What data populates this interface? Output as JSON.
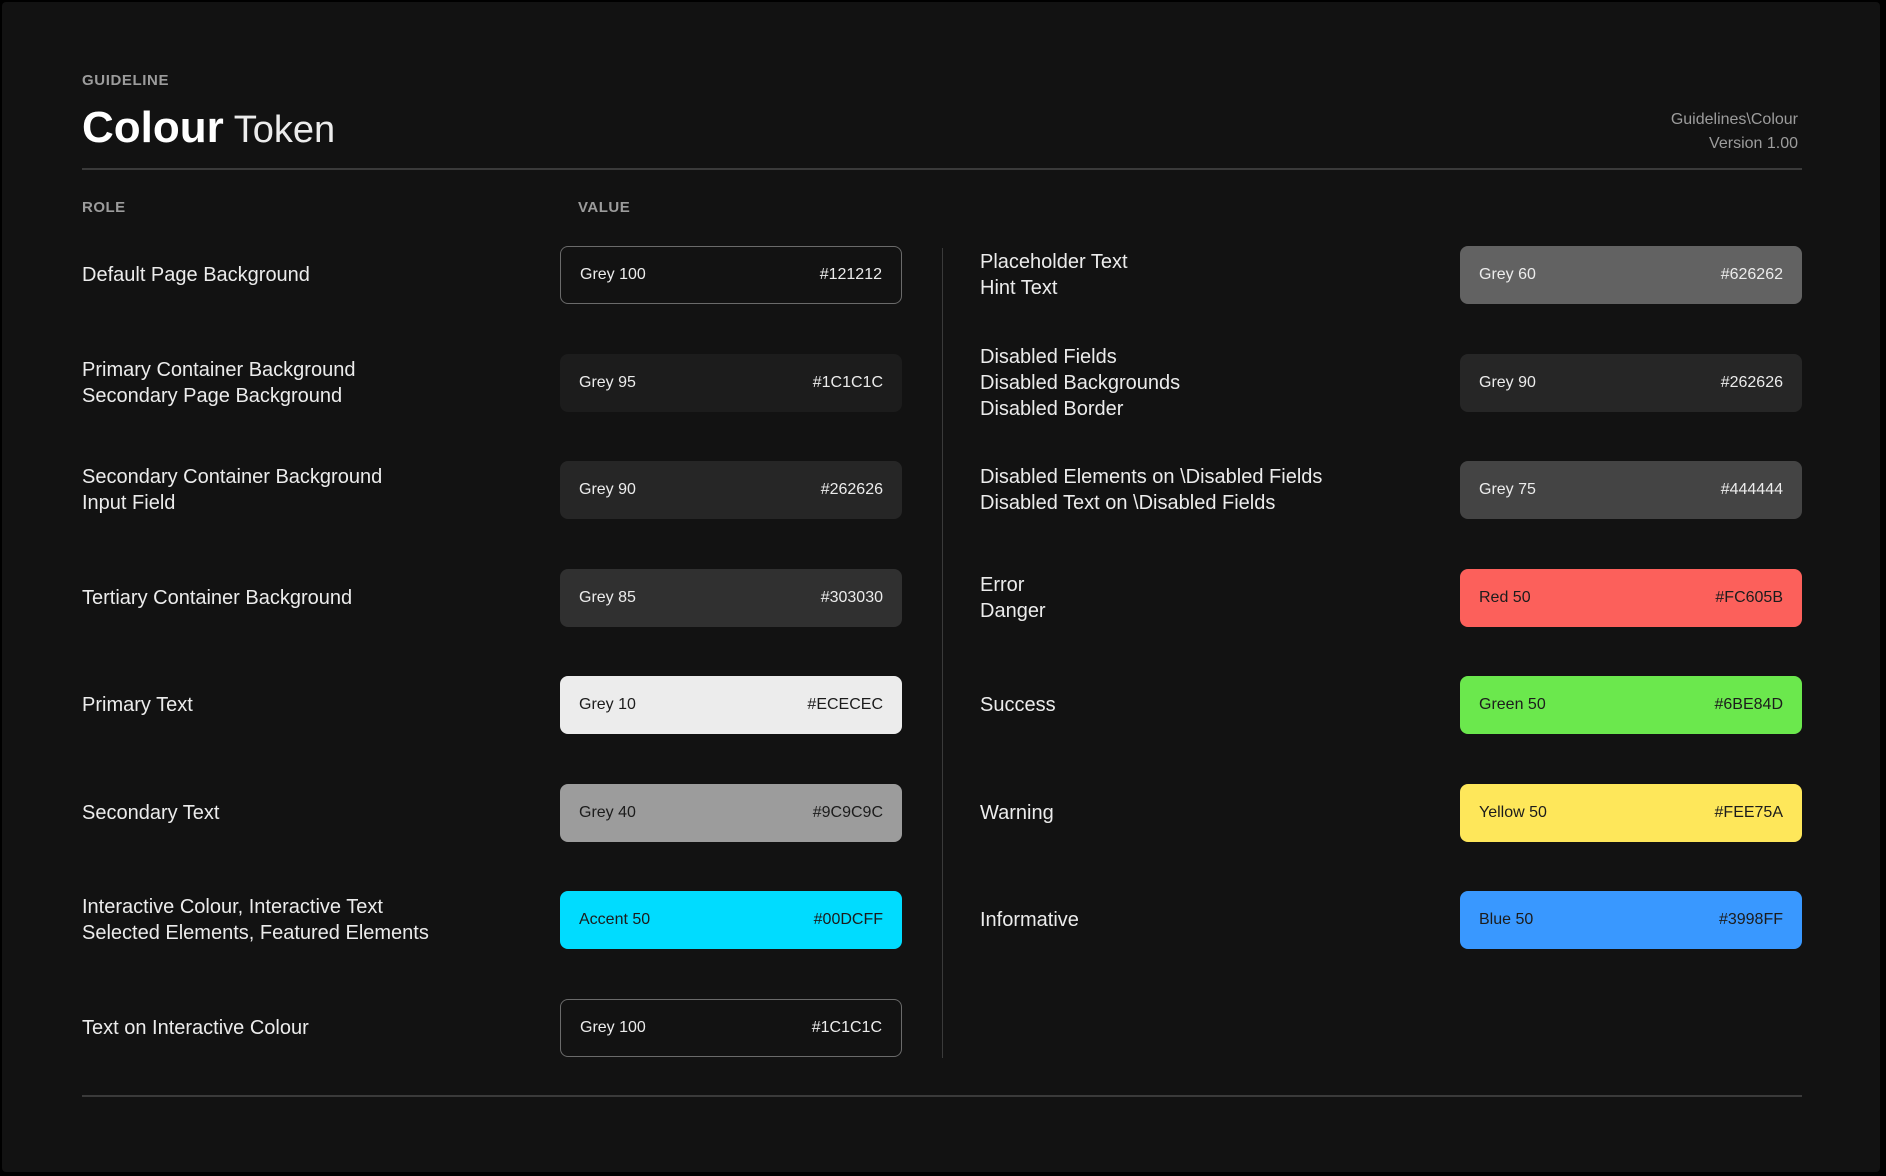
{
  "header": {
    "eyebrow": "GUIDELINE",
    "title_main": "Colour",
    "title_sub": "Token",
    "path": "Guidelines\\Colour",
    "version": "Version 1.00"
  },
  "columns": {
    "role": "ROLE",
    "value": "VALUE"
  },
  "left_tokens": [
    {
      "roles": [
        "Default Page Background"
      ],
      "name": "Grey 100",
      "hex": "#121212",
      "bg": "#121212",
      "fg": "#ECECEC",
      "outlined": true
    },
    {
      "roles": [
        "Primary Container Background",
        "Secondary Page Background"
      ],
      "name": "Grey 95",
      "hex": "#1C1C1C",
      "bg": "#1C1C1C",
      "fg": "#ECECEC",
      "outlined": false
    },
    {
      "roles": [
        "Secondary Container Background",
        "Input Field"
      ],
      "name": "Grey 90",
      "hex": "#262626",
      "bg": "#262626",
      "fg": "#ECECEC",
      "outlined": false
    },
    {
      "roles": [
        "Tertiary Container Background"
      ],
      "name": "Grey 85",
      "hex": "#303030",
      "bg": "#303030",
      "fg": "#ECECEC",
      "outlined": false
    },
    {
      "roles": [
        "Primary Text"
      ],
      "name": "Grey 10",
      "hex": "#ECECEC",
      "bg": "#ECECEC",
      "fg": "#1C1C1C",
      "outlined": false
    },
    {
      "roles": [
        "Secondary Text"
      ],
      "name": "Grey 40",
      "hex": "#9C9C9C",
      "bg": "#9C9C9C",
      "fg": "#1C1C1C",
      "outlined": false
    },
    {
      "roles": [
        "Interactive Colour, Interactive Text",
        "Selected Elements, Featured Elements"
      ],
      "name": "Accent 50",
      "hex": "#00DCFF",
      "bg": "#00DCFF",
      "fg": "#1C1C1C",
      "outlined": false
    },
    {
      "roles": [
        "Text on Interactive Colour"
      ],
      "name": "Grey 100",
      "hex": "#1C1C1C",
      "bg": "#121212",
      "fg": "#ECECEC",
      "outlined": true
    }
  ],
  "right_tokens": [
    {
      "roles": [
        "Placeholder Text",
        "Hint Text"
      ],
      "name": "Grey 60",
      "hex": "#626262",
      "bg": "#626262",
      "fg": "#ECECEC",
      "outlined": false
    },
    {
      "roles": [
        "Disabled Fields",
        "Disabled Backgrounds",
        "Disabled Border"
      ],
      "name": "Grey 90",
      "hex": "#262626",
      "bg": "#262626",
      "fg": "#ECECEC",
      "outlined": false
    },
    {
      "roles": [
        "Disabled Elements on \\Disabled Fields",
        "Disabled Text on \\Disabled Fields"
      ],
      "name": "Grey 75",
      "hex": "#444444",
      "bg": "#444444",
      "fg": "#ECECEC",
      "outlined": false
    },
    {
      "roles": [
        "Error",
        "Danger"
      ],
      "name": "Red 50",
      "hex": "#FC605B",
      "bg": "#FC605B",
      "fg": "#1C1C1C",
      "outlined": false
    },
    {
      "roles": [
        "Success"
      ],
      "name": "Green 50",
      "hex": "#6BE84D",
      "bg": "#6BE84D",
      "fg": "#1C1C1C",
      "outlined": false
    },
    {
      "roles": [
        "Warning"
      ],
      "name": "Yellow 50",
      "hex": "#FEE75A",
      "bg": "#FEE75A",
      "fg": "#1C1C1C",
      "outlined": false
    },
    {
      "roles": [
        "Informative"
      ],
      "name": "Blue 50",
      "hex": "#3998FF",
      "bg": "#3998FF",
      "fg": "#1C1C1C",
      "outlined": false
    }
  ]
}
